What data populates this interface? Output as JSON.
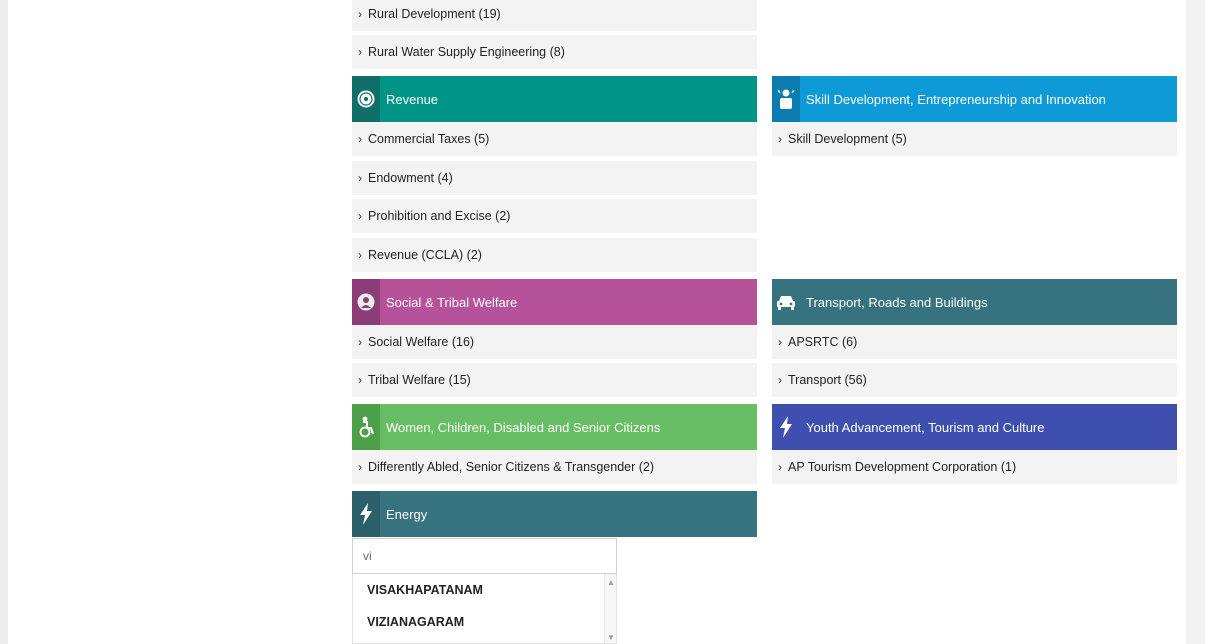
{
  "colors": {
    "revenue": "#009486",
    "revenue_icon_bg": "#0f6e67",
    "skill": "#0d9ad6",
    "skill_icon_bg": "#0b7bb0",
    "social": "#b65299",
    "social_icon_bg": "#8c3d77",
    "transport": "#36737f",
    "transport_icon_bg": "#2b5f69",
    "women": "#68be64",
    "women_icon_bg": "#4e9f4a",
    "youth": "#3e4fb0",
    "youth_icon_bg": "#33439a",
    "energy": "#36737f",
    "energy_icon_bg": "#2b5f69"
  },
  "top_items": [
    {
      "label": "Rural Development (19)"
    },
    {
      "label": "Rural Water Supply Engineering (8)"
    }
  ],
  "revenue": {
    "title": "Revenue",
    "icon": "emblem-icon",
    "items": [
      {
        "label": "Commercial Taxes (5)"
      },
      {
        "label": "Endowment (4)"
      },
      {
        "label": "Prohibition and Excise (2)"
      },
      {
        "label": "Revenue (CCLA) (2)"
      }
    ]
  },
  "skill": {
    "title": "Skill Development, Entrepreneurship and Innovation",
    "icon": "worker-icon",
    "items": [
      {
        "label": "Skill Development (5)"
      }
    ]
  },
  "social": {
    "title": "Social & Tribal Welfare",
    "icon": "seal-icon",
    "items": [
      {
        "label": "Social Welfare (16)"
      },
      {
        "label": "Tribal Welfare (15)"
      }
    ]
  },
  "transport": {
    "title": "Transport, Roads and Buildings",
    "icon": "car-icon",
    "items": [
      {
        "label": "APSRTC (6)"
      },
      {
        "label": "Transport (56)"
      }
    ]
  },
  "women": {
    "title": "Women, Children, Disabled and Senior Citizens",
    "icon": "wheelchair-icon",
    "items": [
      {
        "label": "Differently Abled, Senior Citizens & Transgender (2)"
      }
    ]
  },
  "youth": {
    "title": "Youth Advancement, Tourism and Culture",
    "icon": "lightning-icon",
    "items": [
      {
        "label": "AP Tourism Development Corporation (1)"
      }
    ]
  },
  "energy": {
    "title": "Energy",
    "icon": "lightning-icon"
  },
  "search": {
    "value": "vi",
    "options": [
      "VISAKHAPATANAM",
      "VIZIANAGARAM"
    ]
  }
}
